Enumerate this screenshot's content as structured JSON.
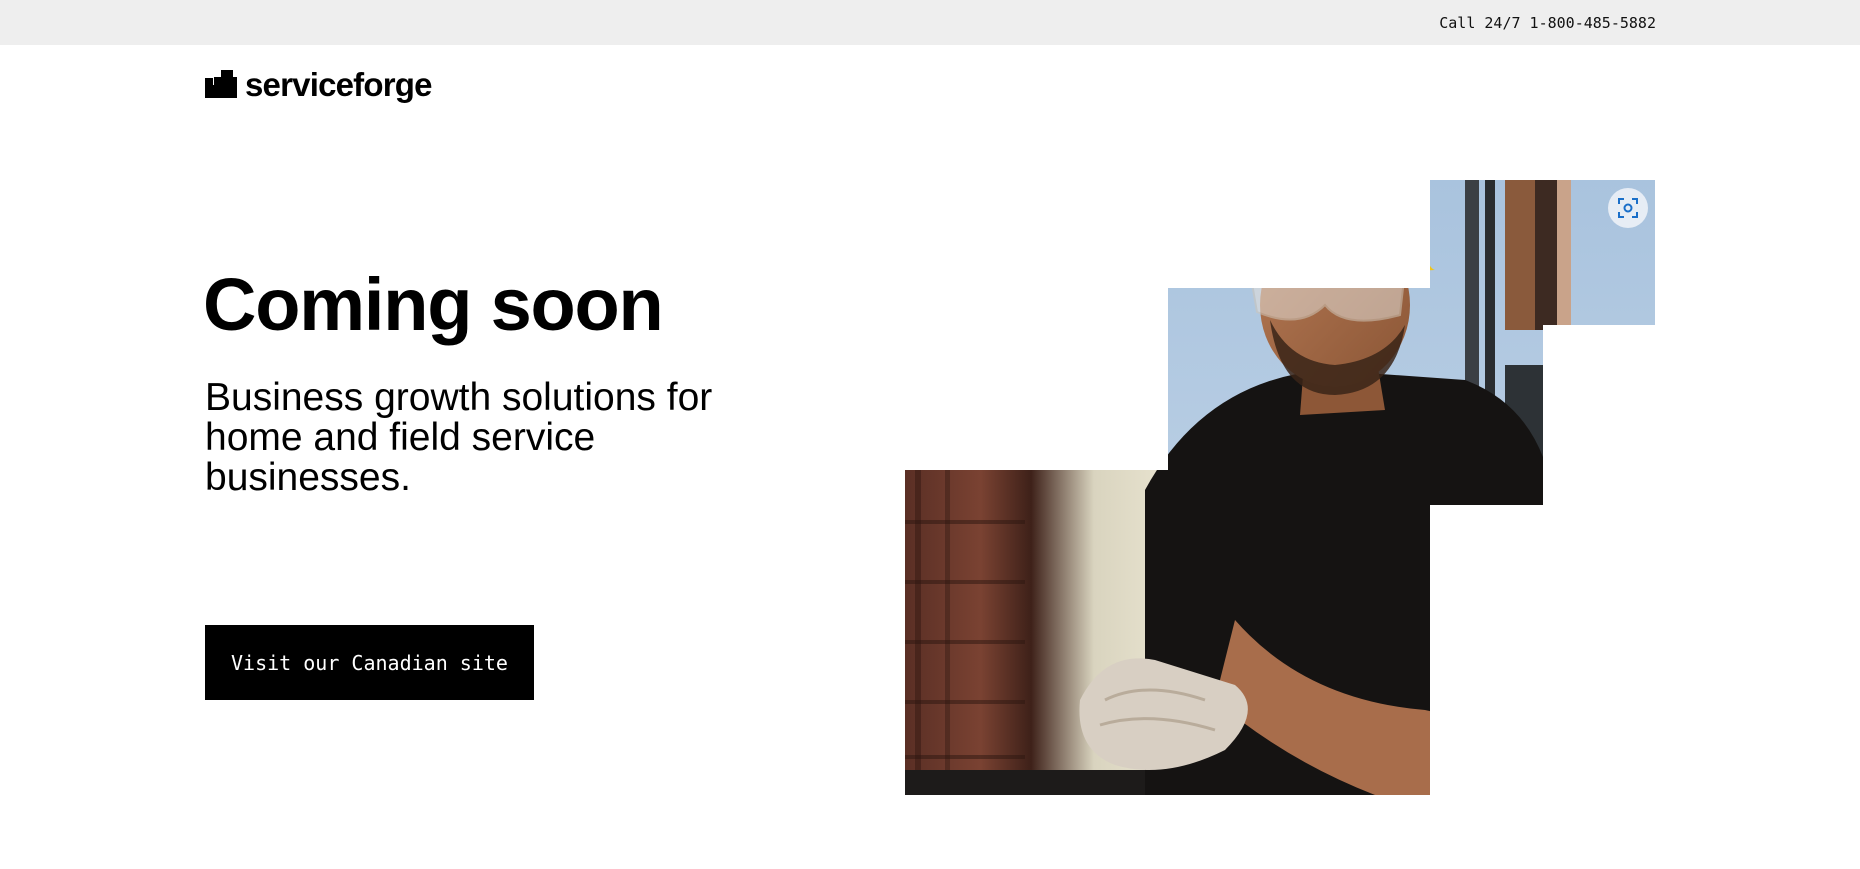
{
  "topbar": {
    "call_text": "Call 24/7 1-800-485-5882"
  },
  "logo": {
    "text": "serviceforge",
    "icon": "stairs-logo-mark"
  },
  "hero": {
    "headline": "Coming soon",
    "subheadline": "Business growth solutions for home and field service businesses.",
    "cta_label": "Visit our Canadian site"
  },
  "image": {
    "icon": "scan-image-icon",
    "accent": "#1a6fc9"
  },
  "colors": {
    "topbar_bg": "#eeeeee",
    "button_bg": "#000000",
    "button_text": "#ffffff",
    "helmet": "#f2c518"
  }
}
